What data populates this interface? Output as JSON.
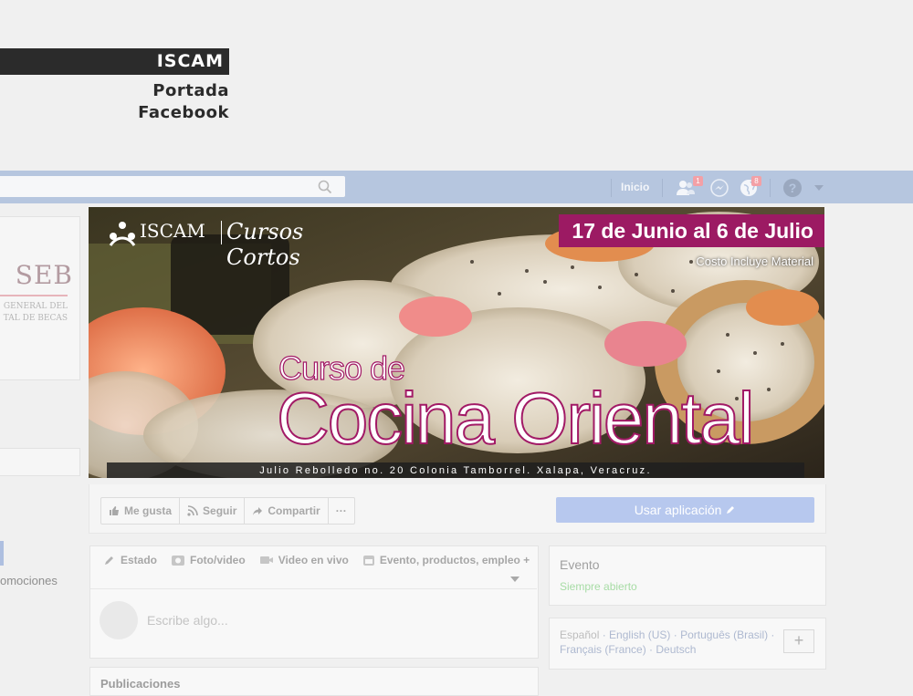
{
  "header": {
    "title": "ISCAM",
    "subtitle_line1": "Portada",
    "subtitle_line2": "Facebook"
  },
  "topbar": {
    "nav_home": "Inicio",
    "friend_requests_count": "1",
    "notifications_count": "8",
    "icons": [
      "search-icon",
      "friends-icon",
      "messenger-icon",
      "globe-icon",
      "help-icon",
      "caret-down-icon"
    ]
  },
  "left": {
    "logo_text": "SEB",
    "logo_line1": "GENERAL DEL",
    "logo_line2": "TAL DE BECAS",
    "promo_text": "omociones"
  },
  "cover": {
    "brand_name": "ISCAM",
    "brand_product": "Cursos Cortos",
    "date_range": "17 de Junio al 6 de Julio",
    "costo": "Costo Incluye Material",
    "title_small": "Curso de",
    "title_big": "Cocina Oriental",
    "address": "Julio Rebolledo no. 20 Colonia Tamborrel. Xalapa, Veracruz.",
    "colors": {
      "accent": "#9c1a63"
    }
  },
  "actions": {
    "like": "Me gusta",
    "follow": "Seguir",
    "share": "Compartir",
    "more": "···",
    "use_app": "Usar aplicación"
  },
  "composer": {
    "tabs": [
      "Estado",
      "Foto/video",
      "Video en vivo",
      "Evento, productos, empleo +"
    ],
    "placeholder": "Escribe algo...",
    "publications_title": "Publicaciones"
  },
  "sidebar": {
    "event_title": "Evento",
    "event_status": "Siempre abierto",
    "languages": {
      "current": "Español",
      "others_line1": "English (US) · Português (Brasil) ·",
      "others_line2": "Français (France) · Deutsch"
    },
    "add_language": "+"
  }
}
